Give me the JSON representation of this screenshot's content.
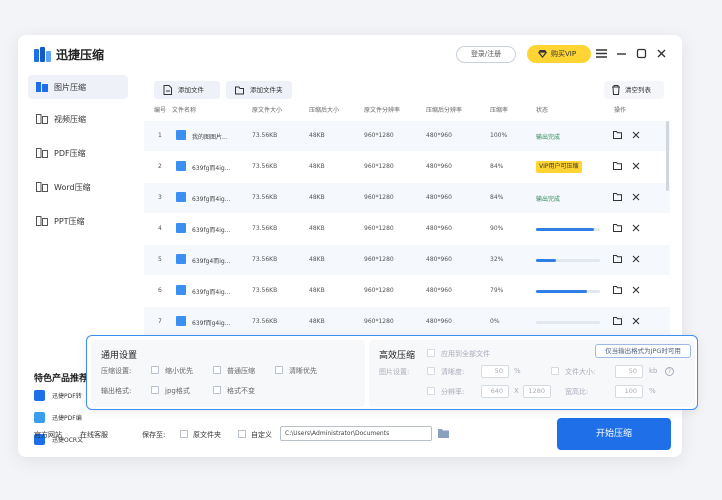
{
  "app": {
    "title": "迅捷压缩",
    "login": "登录/注册",
    "vip": "购买VIP",
    "accent": "#1d6fe8",
    "vip_color": "#ffd433"
  },
  "window_controls": [
    "menu-icon",
    "minimize-icon",
    "maximize-icon",
    "close-icon"
  ],
  "sidebar": {
    "items": [
      {
        "label": "图片压缩",
        "icon": "image-compress-icon",
        "active": true
      },
      {
        "label": "视频压缩",
        "icon": "video-compress-icon",
        "active": false
      },
      {
        "label": "PDF压缩",
        "icon": "pdf-compress-icon",
        "active": false
      },
      {
        "label": "Word压缩",
        "icon": "word-compress-icon",
        "active": false
      },
      {
        "label": "PPT压缩",
        "icon": "ppt-compress-icon",
        "active": false
      }
    ],
    "featured_title": "特色产品推荐",
    "featured": [
      {
        "label": "迅捷PDF转",
        "color": "#1d6fe8"
      },
      {
        "label": "迅捷PDF编",
        "color": "#3a9df0"
      },
      {
        "label": "迅捷OCR文",
        "color": "#1d6fe8"
      }
    ]
  },
  "toolbar": {
    "add_file": "添加文件",
    "add_folder": "添加文件夹",
    "clear": "清空列表"
  },
  "table": {
    "headers": [
      "编号",
      "文件名称",
      "原文件大小",
      "压缩后大小",
      "原文件分辨率",
      "压缩后分辨率",
      "压缩率",
      "状态",
      "操作"
    ],
    "rows": [
      {
        "no": "1",
        "name": "我的图图片...",
        "orig_size": "73.56KB",
        "new_size": "48KB",
        "orig_res": "960*1280",
        "new_res": "480*960",
        "rate": "100%",
        "status": "输出完成",
        "status_type": "done"
      },
      {
        "no": "2",
        "name": "639fg而4ig...",
        "orig_size": "73.56KB",
        "new_size": "48KB",
        "orig_res": "960*1280",
        "new_res": "480*960",
        "rate": "84%",
        "status": "VIP用户可压缩",
        "status_type": "vip"
      },
      {
        "no": "3",
        "name": "639fg而4ig...",
        "orig_size": "73.56KB",
        "new_size": "48KB",
        "orig_res": "960*1280",
        "new_res": "480*960",
        "rate": "84%",
        "status": "输出完成",
        "status_type": "done"
      },
      {
        "no": "4",
        "name": "639fg而4ig...",
        "orig_size": "73.56KB",
        "new_size": "48KB",
        "orig_res": "960*1280",
        "new_res": "480*960",
        "rate": "90%",
        "status": "",
        "status_type": "progress",
        "progress": 0.9
      },
      {
        "no": "5",
        "name": "639fg4而ig...",
        "orig_size": "73.56KB",
        "new_size": "48KB",
        "orig_res": "960*1280",
        "new_res": "480*960",
        "rate": "32%",
        "status": "",
        "status_type": "progress",
        "progress": 0.32
      },
      {
        "no": "6",
        "name": "639fg而4ig...",
        "orig_size": "73.56KB",
        "new_size": "48KB",
        "orig_res": "960*1280",
        "new_res": "480*960",
        "rate": "79%",
        "status": "",
        "status_type": "progress",
        "progress": 0.79
      },
      {
        "no": "7",
        "name": "639f而g4ig...",
        "orig_size": "73.56KB",
        "new_size": "48KB",
        "orig_res": "960*1280",
        "new_res": "480*960",
        "rate": "0%",
        "status": "",
        "status_type": "progress",
        "progress": 0
      }
    ]
  },
  "settings": {
    "general_title": "通用设置",
    "mode_label": "压缩设置:",
    "modes": [
      "缩小优先",
      "普通压缩",
      "清晰优先"
    ],
    "format_label": "输出格式:",
    "formats": [
      "jpg格式",
      "格式不变"
    ],
    "efficient_title": "高效压缩",
    "apply_all": "应用到全部文件",
    "jpg_only": "仅当输出格式为JPG时可用",
    "image_setting": "图片设置:",
    "clarity_label": "清晰度:",
    "clarity_value": "50",
    "clarity_unit": "%",
    "filesize_label": "文件大小:",
    "filesize_value": "50",
    "filesize_unit": "kb",
    "resolution_label": "分辨率:",
    "res_w": "640",
    "res_x": "X",
    "res_h": "1280",
    "aspect_label": "宽高比:",
    "aspect_value": "100",
    "aspect_unit": "%"
  },
  "footer": {
    "website": "官方网站",
    "service": "在线客服",
    "save_to": "保存至:",
    "orig_folder": "原文件夹",
    "custom": "自定义",
    "path": "C:\\Users\\Administrator\\Documents",
    "start": "开始压缩"
  }
}
